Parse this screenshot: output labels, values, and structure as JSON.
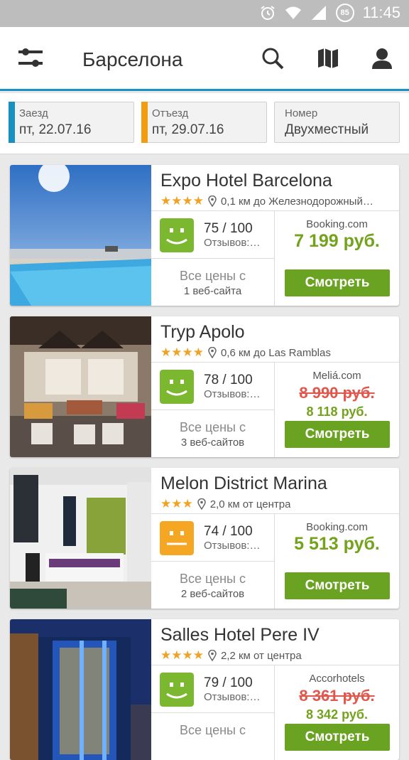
{
  "status": {
    "time": "11:45",
    "battery": "85"
  },
  "header": {
    "title": "Барселона"
  },
  "dates": {
    "checkin": {
      "label": "Заезд",
      "value": "пт, 22.07.16",
      "color": "#1a8fc2"
    },
    "checkout": {
      "label": "Отъезд",
      "value": "пт, 29.07.16",
      "color": "#f39c12"
    },
    "room": {
      "label": "Номер",
      "value": "Двухместный"
    }
  },
  "hotels": [
    {
      "name": "Expo Hotel Barcelona",
      "stars": "★★★★",
      "distance": "0,1 км до Железнодорожный…",
      "score": "75 / 100",
      "reviews": "Отзывов:…",
      "face": "green",
      "allprices": "Все цены с",
      "sites": "1 веб-сайта",
      "provider": "Booking.com",
      "price": "7 199 руб.",
      "old_price": "",
      "button": "Смотреть"
    },
    {
      "name": "Tryp Apolo",
      "stars": "★★★★",
      "distance": "0,6 км до Las Ramblas",
      "score": "78 / 100",
      "reviews": "Отзывов:…",
      "face": "green",
      "allprices": "Все цены с",
      "sites": "3 веб-сайтов",
      "provider": "Meliá.com",
      "price": "8 118 руб.",
      "old_price": "8 990 руб.",
      "button": "Смотреть"
    },
    {
      "name": "Melon District Marina",
      "stars": "★★★",
      "distance": "2,0 км от центра",
      "score": "74 / 100",
      "reviews": "Отзывов:…",
      "face": "orange",
      "allprices": "Все цены с",
      "sites": "2 веб-сайтов",
      "provider": "Booking.com",
      "price": "5 513 руб.",
      "old_price": "",
      "button": "Смотреть"
    },
    {
      "name": "Salles Hotel Pere IV",
      "stars": "★★★★",
      "distance": "2,2 км от центра",
      "score": "79 / 100",
      "reviews": "Отзывов:…",
      "face": "green",
      "allprices": "Все цены с",
      "sites": "",
      "provider": "Accorhotels",
      "price": "8 342 руб.",
      "old_price": "8 361 руб.",
      "button": "Смотреть"
    }
  ],
  "colors": {
    "accent": "#1a8fc2",
    "good": "#6aa221",
    "face_green": "#7cb82f",
    "face_orange": "#f5a623",
    "old_price": "#e2574c"
  }
}
